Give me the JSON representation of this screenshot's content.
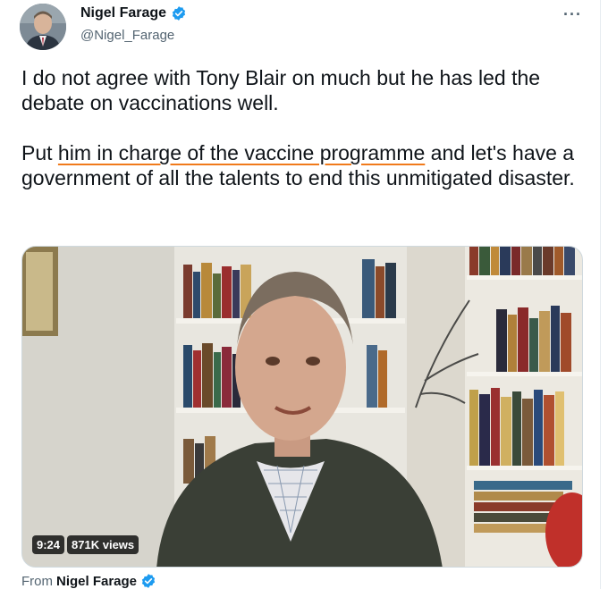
{
  "author": {
    "display_name": "Nigel Farage",
    "handle": "@Nigel_Farage"
  },
  "menu": {
    "more_label": "···"
  },
  "tweet": {
    "para1": "I do not agree with Tony Blair on much but he has led the debate on vaccinations well.",
    "para2_before": "Put ",
    "para2_highlight": "him in charge of the vaccine programme",
    "para2_after": " and let's have a government of all the talents to end this unmitigated disaster."
  },
  "video": {
    "duration": "9:24",
    "views": "871K views"
  },
  "attribution": {
    "from_label": "From",
    "from_name": "Nigel Farage"
  },
  "colors": {
    "verified": "#1d9bf0",
    "highlight_underline": "#f07a1b",
    "secondary_text": "#536471"
  },
  "icons": {
    "verified": "verified-badge-icon",
    "more": "more-options-icon",
    "avatar": "avatar-image"
  }
}
